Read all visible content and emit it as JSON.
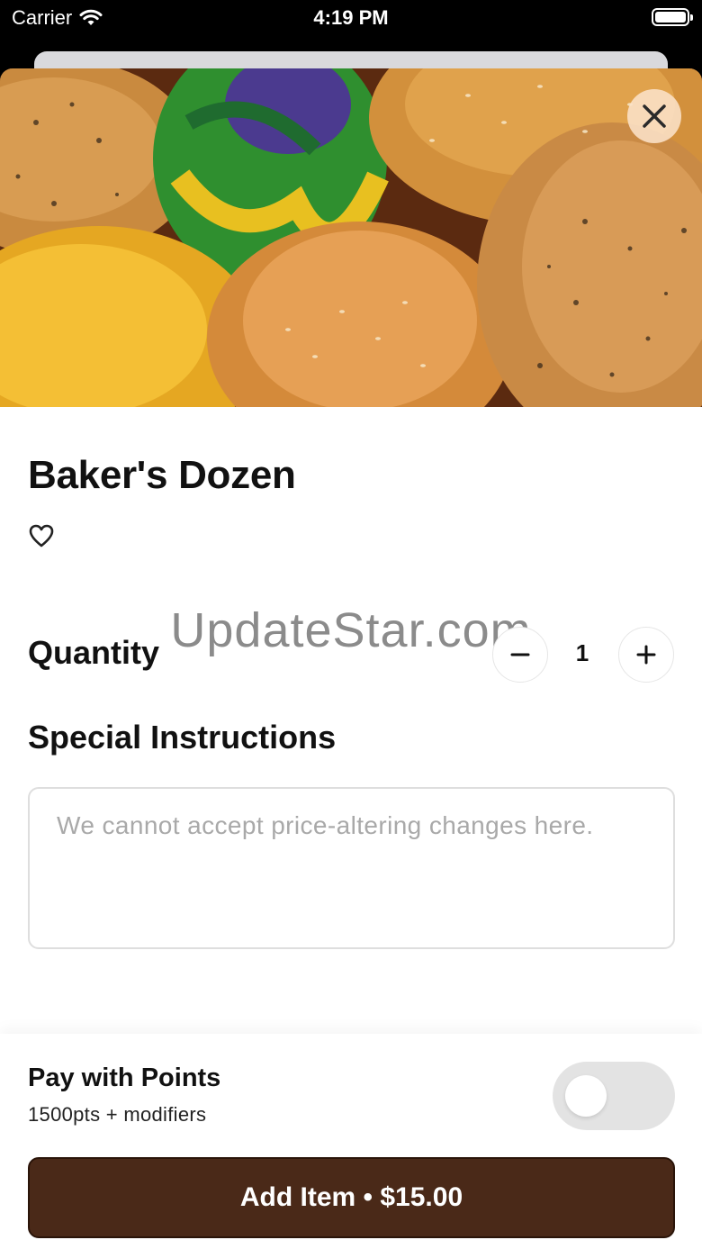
{
  "status_bar": {
    "carrier": "Carrier",
    "time": "4:19 PM",
    "battery_level": 1.0
  },
  "hero": {
    "image": "bagels-photo",
    "close_icon": "close-icon"
  },
  "item": {
    "title": "Baker's Dozen",
    "favorite_icon": "heart-outline-icon"
  },
  "watermark": "UpdateStar.com",
  "quantity": {
    "label": "Quantity",
    "value": "1",
    "minus_icon": "minus-icon",
    "plus_icon": "plus-icon"
  },
  "special_instructions": {
    "label": "Special Instructions",
    "value": "",
    "placeholder": "We cannot accept price-altering changes here."
  },
  "footer": {
    "points_title": "Pay with Points",
    "points_subtitle": "1500pts + modifiers",
    "points_toggle_on": false,
    "add_button_label": "Add Item • $15.00"
  },
  "colors": {
    "add_button": "#4a2918",
    "toggle_off": "#e3e3e3",
    "close_button_bg": "#fae1c8"
  }
}
